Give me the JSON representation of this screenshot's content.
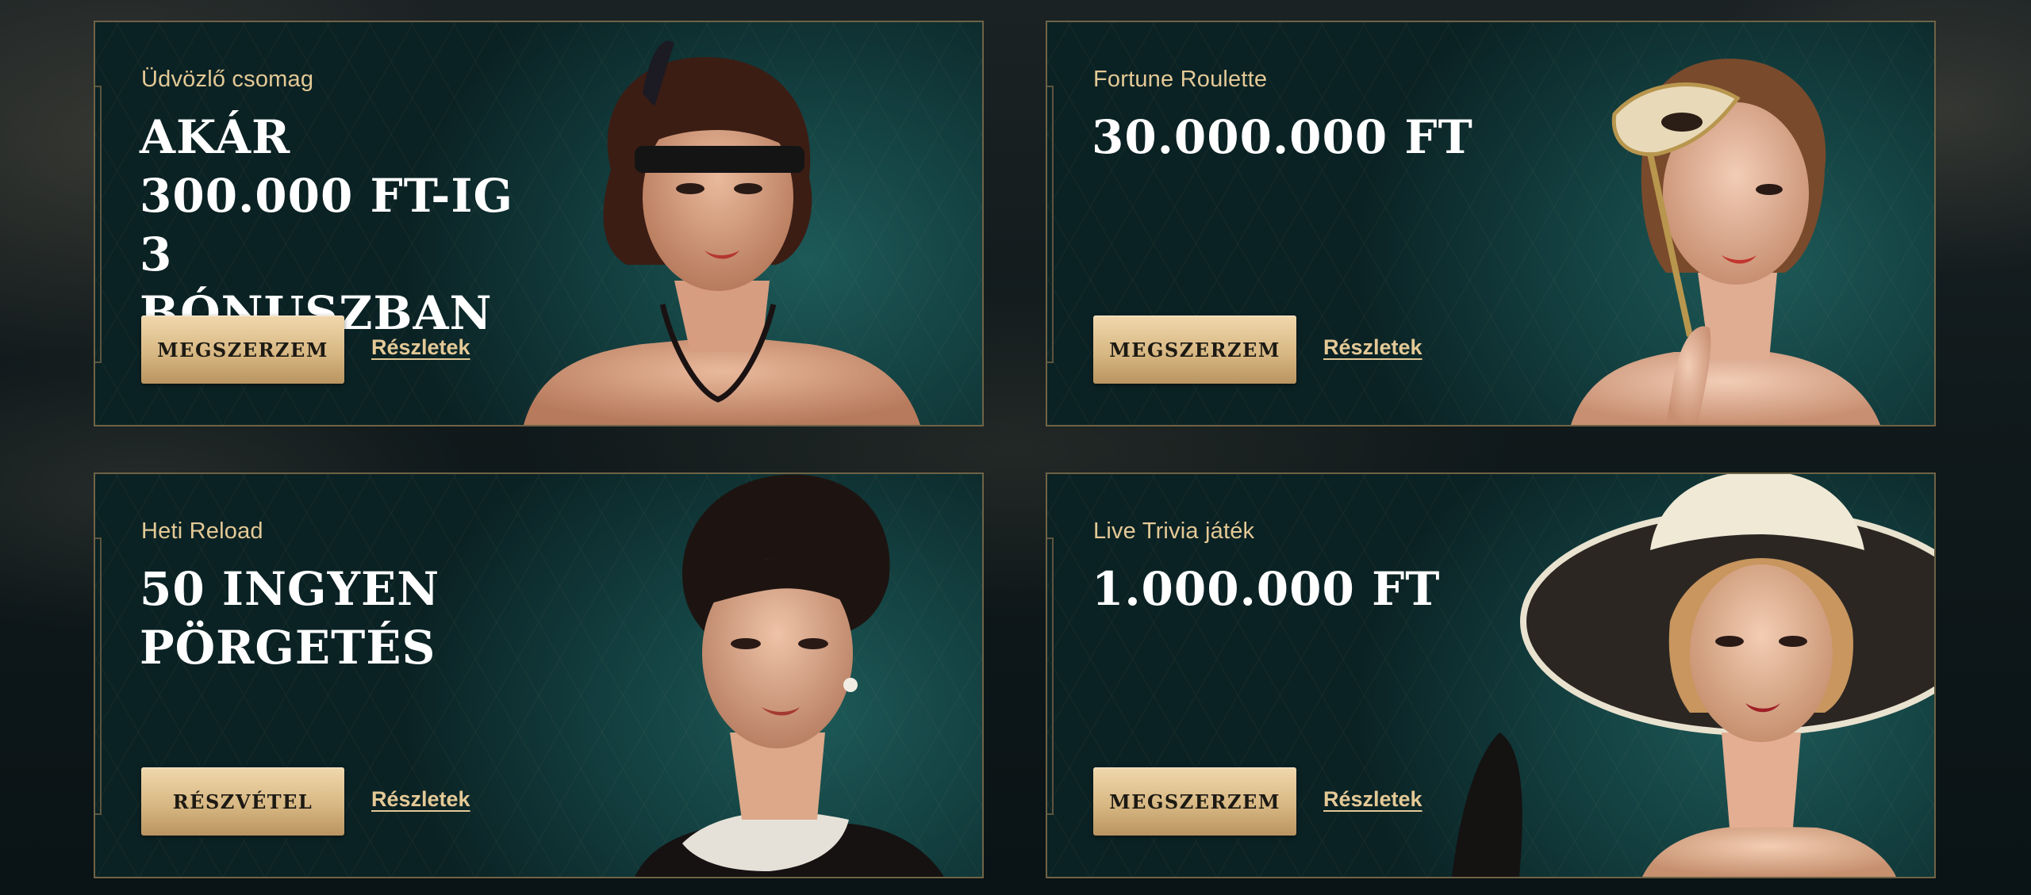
{
  "promos": [
    {
      "subtitle": "Üdvözlő csomag",
      "headline": "AKÁR 300.000 FT-IG 3 BÓNUSZBAN",
      "cta": "MEGSZERZEM",
      "link": "Részletek"
    },
    {
      "subtitle": "Fortune Roulette",
      "headline": "30.000.000 FT",
      "cta": "MEGSZERZEM",
      "link": "Részletek"
    },
    {
      "subtitle": "Heti Reload",
      "headline": "50 INGYEN PÖRGETÉS",
      "cta": "RÉSZVÉTEL",
      "link": "Részletek"
    },
    {
      "subtitle": "Live Trivia játék",
      "headline": "1.000.000 FT",
      "cta": "MEGSZERZEM",
      "link": "Részletek"
    }
  ],
  "colors": {
    "accent_gold": "#e4c996",
    "card_teal": "#123b3c",
    "border": "#6f6346",
    "button_gold": "#d8b883"
  }
}
